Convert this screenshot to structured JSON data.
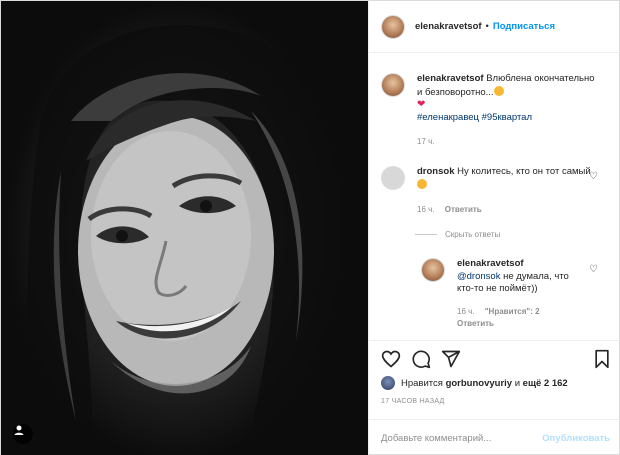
{
  "post": {
    "username": "elenakravetsof",
    "follow_label": "Подписаться",
    "dot": "•"
  },
  "caption": {
    "username": "elenakravetsof",
    "text": "Влюблена окончательно и безповоротно...",
    "hashtags": "#еленакравец #95квартал",
    "time": "17 ч."
  },
  "comments": [
    {
      "username": "dronsok",
      "text": "Ну колитесь, кто он тот самый",
      "time": "16 ч.",
      "reply_label": "Ответить"
    }
  ],
  "hide_replies_label": "Скрыть ответы",
  "reply": {
    "username": "elenakravetsof",
    "mention": "@dronsok",
    "text": " не думала, что кто-то не поймёт))",
    "time": "16 ч.",
    "likes": "\"Нравится\": 2",
    "reply_label": "Ответить"
  },
  "likes": {
    "prefix": "Нравится",
    "user": "gorbunovyuriy",
    "and": "и",
    "count": "ещё 2 162"
  },
  "posted": "17 ЧАСОВ НАЗАД",
  "add_comment": {
    "placeholder": "Добавьте комментарий...",
    "publish_label": "Опубликовать"
  },
  "icons": {
    "like": "heart-outline-icon",
    "comment": "comment-bubble-icon",
    "share": "paper-plane-icon",
    "save": "bookmark-icon"
  }
}
